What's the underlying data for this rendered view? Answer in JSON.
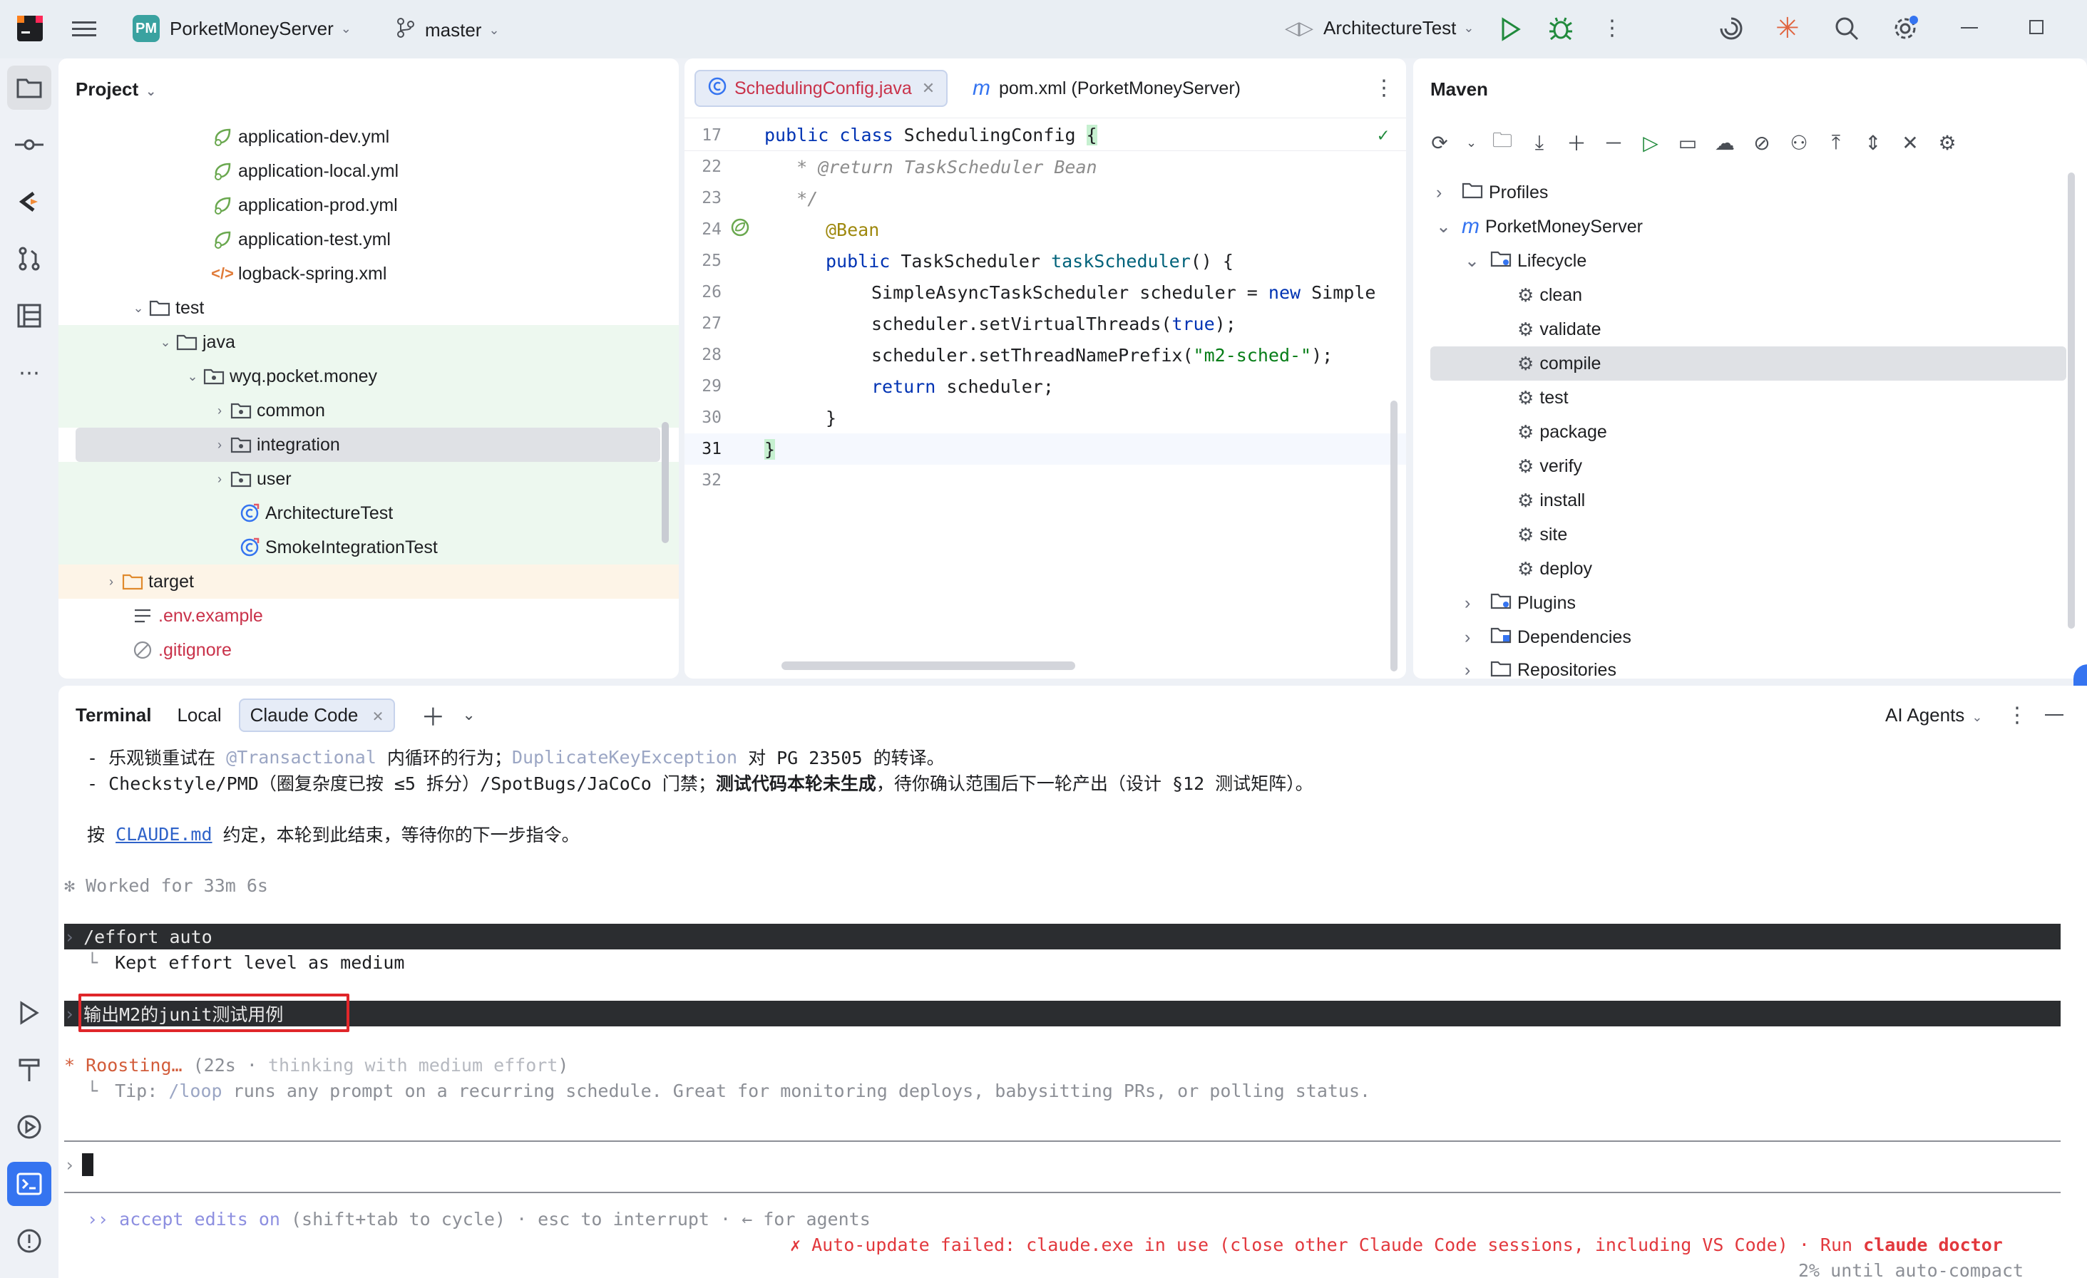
{
  "topbar": {
    "project_badge": "PM",
    "project_name": "PorketMoneyServer",
    "branch": "master",
    "run_config": "ArchitectureTest"
  },
  "project_panel": {
    "title": "Project",
    "rows": [
      {
        "label": "application-dev.yml",
        "type": "yml"
      },
      {
        "label": "application-local.yml",
        "type": "yml"
      },
      {
        "label": "application-prod.yml",
        "type": "yml"
      },
      {
        "label": "application-test.yml",
        "type": "yml"
      },
      {
        "label": "logback-spring.xml",
        "type": "xml"
      },
      {
        "label": "test",
        "type": "folder"
      },
      {
        "label": "java",
        "type": "folder"
      },
      {
        "label": "wyq.pocket.money",
        "type": "package"
      },
      {
        "label": "common",
        "type": "package"
      },
      {
        "label": "integration",
        "type": "package"
      },
      {
        "label": "user",
        "type": "package"
      },
      {
        "label": "ArchitectureTest",
        "type": "class"
      },
      {
        "label": "SmokeIntegrationTest",
        "type": "class"
      },
      {
        "label": "target",
        "type": "folder-orange"
      },
      {
        "label": ".env.example",
        "type": "text"
      },
      {
        "label": ".gitignore",
        "type": "ignore"
      }
    ]
  },
  "editor": {
    "tabs": [
      {
        "label": "SchedulingConfig.java",
        "active": true
      },
      {
        "label": "pom.xml (PorketMoneyServer)",
        "active": false
      }
    ],
    "line_numbers": [
      "17",
      "22",
      "23",
      "24",
      "25",
      "26",
      "27",
      "28",
      "29",
      "30",
      "31",
      "32"
    ],
    "lines": {
      "l17_kw": "public class ",
      "l17_name": "SchedulingConfig ",
      "l17_brace": "{",
      "l22": "   * @return TaskScheduler Bean",
      "l23": "   */",
      "l24": "@Bean",
      "l25_kw": "public ",
      "l25_type": "TaskScheduler ",
      "l25_fn": "taskScheduler",
      "l25_rest": "() {",
      "l26_a": "SimpleAsyncTaskScheduler scheduler = ",
      "l26_kw": "new ",
      "l26_b": "Simple",
      "l27_a": "scheduler.setVirtualThreads(",
      "l27_kw": "true",
      "l27_b": ");",
      "l28_a": "scheduler.setThreadNamePrefix(",
      "l28_str": "\"m2-sched-\"",
      "l28_b": ");",
      "l29_kw": "return ",
      "l29_b": "scheduler;",
      "l30": "}",
      "l31": "}"
    }
  },
  "maven": {
    "title": "Maven",
    "rows": [
      {
        "label": "Profiles"
      },
      {
        "label": "PorketMoneyServer"
      },
      {
        "label": "Lifecycle"
      },
      {
        "label": "clean"
      },
      {
        "label": "validate"
      },
      {
        "label": "compile"
      },
      {
        "label": "test"
      },
      {
        "label": "package"
      },
      {
        "label": "verify"
      },
      {
        "label": "install"
      },
      {
        "label": "site"
      },
      {
        "label": "deploy"
      },
      {
        "label": "Plugins"
      },
      {
        "label": "Dependencies"
      },
      {
        "label": "Repositories"
      }
    ]
  },
  "terminal": {
    "tabs": [
      "Terminal",
      "Local",
      "Claude Code"
    ],
    "ai_agents": "AI Agents",
    "lines": {
      "l1_a": "- 乐观锁重试在 ",
      "l1_b": "@Transactional",
      "l1_c": " 内循环的行为；",
      "l1_d": "DuplicateKeyException",
      "l1_e": " 对 PG 23505 的转译。",
      "l2_a": "- Checkstyle/PMD（圈复杂度已按 ≤5 拆分）/SpotBugs/JaCoCo 门禁；",
      "l2_b": "测试代码本轮未生成",
      "l2_c": "，待你确认范围后下一轮产出（设计 §12 测试矩阵）。",
      "l3_a": "按 ",
      "l3_link": "CLAUDE.md",
      "l3_b": " 约定，本轮到此结束，等待你的下一步指令。",
      "worked": "✻ Worked for 33m 6s",
      "cmd_effort": "/effort auto",
      "effort_result": "Kept effort level as medium",
      "user_prompt": "输出M2的junit测试用例",
      "status_star": "* ",
      "status_word": "Roosting…",
      "status_rest_a": " (22s · ",
      "status_rest_b": "thinking with medium effort",
      "status_rest_c": ")",
      "tip_a": "Tip: ",
      "tip_loop": "/loop",
      "tip_b": " runs any prompt on a recurring schedule. Great for monitoring deploys, babysitting PRs, or polling status.",
      "prompt_char": "›",
      "accept_a": "›› ",
      "accept_b": "accept edits on",
      "accept_c": " (shift+tab to cycle) · esc to interrupt · ← for agents",
      "update_err_a": "✗ Auto-update failed: claude.exe in use (close other Claude Code sessions, including VS Code) · Run ",
      "update_err_b": "claude doctor",
      "compact": "2% until auto-compact"
    }
  }
}
